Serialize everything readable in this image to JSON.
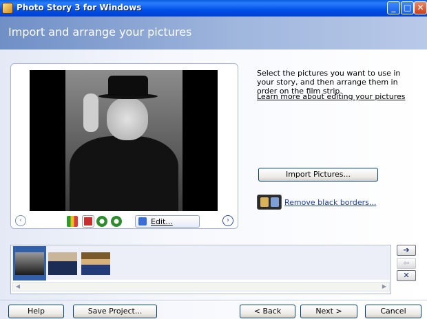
{
  "window": {
    "title": "Photo Story 3 for Windows",
    "controls": {
      "minimize": "_",
      "maximize": "□",
      "close": "✕"
    }
  },
  "header": {
    "title": "Import and arrange your pictures"
  },
  "preview": {
    "tools": [
      "levels-icon",
      "red-eye-icon",
      "rotate-left-icon",
      "rotate-right-icon"
    ],
    "edit_label": "Edit...",
    "prev_symbol": "‹",
    "next_symbol": "›"
  },
  "instructions": {
    "text": "Select the pictures you want to use in your story, and then arrange them in order on the film strip.",
    "learn_link": "Learn more about editing your pictures"
  },
  "actions": {
    "import_label": "Import Pictures...",
    "remove_borders_label": "Remove black borders..."
  },
  "filmstrip": {
    "thumbnails": [
      {
        "name": "thumb-1",
        "selected": true
      },
      {
        "name": "thumb-2",
        "selected": false
      },
      {
        "name": "thumb-3",
        "selected": false
      }
    ],
    "side_buttons": {
      "move_right": "➔",
      "move_left": "⇦",
      "remove": "✕"
    }
  },
  "footer": {
    "help": "Help",
    "save_project": "Save Project...",
    "back": "< Back",
    "next": "Next >",
    "cancel": "Cancel"
  },
  "colors": {
    "title_blue": "#0050e8",
    "accent_link": "#1f3f8f",
    "panel_border": "#a6b5d4"
  }
}
